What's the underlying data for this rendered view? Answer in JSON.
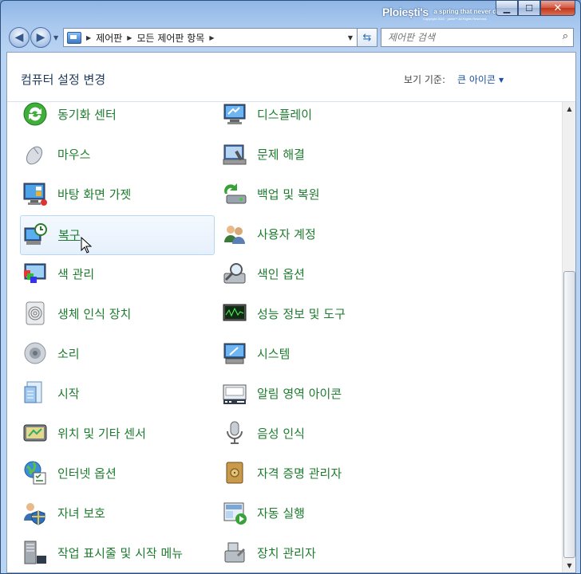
{
  "branding": {
    "name": "Ploiești's",
    "tagline": "a spring that never dries",
    "copyright": "Copyright 2022 · jamie** All Rights Reserved."
  },
  "window_buttons": {
    "minimize": "▁",
    "maximize": "☐",
    "close": "✕"
  },
  "nav": {
    "back_icon": "back-arrow-icon",
    "forward_icon": "forward-arrow-icon",
    "breadcrumbs": [
      "제어판",
      "모든 제어판 항목"
    ],
    "search_placeholder": "제어판 검색"
  },
  "header": {
    "title": "컴퓨터 설정 변경",
    "view_by_label": "보기 기준:",
    "view_by_value": "큰 아이콘"
  },
  "colors": {
    "item_text": "#1d7c2e",
    "link": "#1a4fa0",
    "title": "#1e395b"
  },
  "items": [
    {
      "label": "동기화 센터",
      "icon": "sync-center-icon"
    },
    {
      "label": "디스플레이",
      "icon": "display-icon"
    },
    {
      "label": "마우스",
      "icon": "mouse-icon"
    },
    {
      "label": "문제 해결",
      "icon": "troubleshooting-icon"
    },
    {
      "label": "바탕 화면 가젯",
      "icon": "desktop-gadgets-icon"
    },
    {
      "label": "백업 및 복원",
      "icon": "backup-restore-icon"
    },
    {
      "label": "복구",
      "icon": "recovery-icon"
    },
    {
      "label": "사용자 계정",
      "icon": "user-accounts-icon"
    },
    {
      "label": "색 관리",
      "icon": "color-management-icon"
    },
    {
      "label": "색인 옵션",
      "icon": "indexing-options-icon"
    },
    {
      "label": "생체 인식 장치",
      "icon": "biometric-devices-icon"
    },
    {
      "label": "성능 정보 및 도구",
      "icon": "performance-tools-icon"
    },
    {
      "label": "소리",
      "icon": "sound-icon"
    },
    {
      "label": "시스템",
      "icon": "system-icon"
    },
    {
      "label": "시작",
      "icon": "getting-started-icon"
    },
    {
      "label": "알림 영역 아이콘",
      "icon": "notification-area-icon"
    },
    {
      "label": "위치 및 기타 센서",
      "icon": "location-sensors-icon"
    },
    {
      "label": "음성 인식",
      "icon": "speech-recognition-icon"
    },
    {
      "label": "인터넷 옵션",
      "icon": "internet-options-icon"
    },
    {
      "label": "자격 증명 관리자",
      "icon": "credential-manager-icon"
    },
    {
      "label": "자녀 보호",
      "icon": "parental-controls-icon"
    },
    {
      "label": "자동 실행",
      "icon": "autoplay-icon"
    },
    {
      "label": "작업 표시줄 및 시작 메뉴",
      "icon": "taskbar-start-menu-icon"
    },
    {
      "label": "장치 관리자",
      "icon": "device-manager-icon"
    }
  ],
  "hovered_item": "복구"
}
